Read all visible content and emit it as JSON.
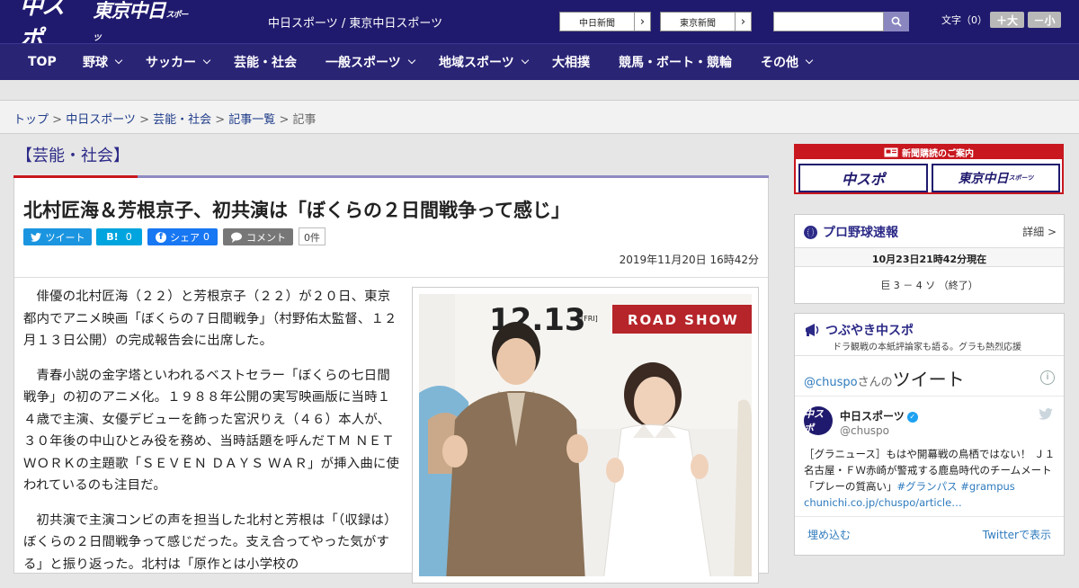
{
  "header": {
    "logo_chuspo": "中スポ",
    "logo_tokyo": "東京中日",
    "logo_tokyo_small": "スポーツ",
    "sites": "中日スポーツ / 東京中日スポーツ",
    "link_chunichi": "中日新聞",
    "link_tokyo": "東京新聞",
    "search_placeholder": "",
    "fontsize_label": "文字（0）",
    "font_plus": "＋大",
    "font_minus": "－小",
    "brand_color": "#201a6e"
  },
  "nav": {
    "items": [
      "TOP",
      "野球",
      "サッカー",
      "芸能・社会",
      "一般スポーツ",
      "地域スポーツ",
      "大相撲",
      "競馬・ボート・競輪",
      "その他"
    ]
  },
  "breadcrumb": {
    "top": "トップ",
    "chuspo": "中日スポーツ",
    "geino": "芸能・社会",
    "list": "記事一覧",
    "current": "記事",
    "sep": " > "
  },
  "article": {
    "category": "【芸能・社会】",
    "headline": "北村匠海＆芳根京子、初共演は「ぼくらの２日間戦争って感じ」",
    "tweet_label": "ツイート",
    "hatena_label": "B!",
    "hatena_count": "0",
    "fb_label": "シェア",
    "fb_count": "0",
    "comment_label": "コメント",
    "comment_count": "0件",
    "date": "2019年11月20日 16時42分",
    "paragraphs": [
      "俳優の北村匠海（２２）と芳根京子（２２）が２０日、東京都内でアニメ映画「ぼくらの７日間戦争」（村野佑太監督、１２月１３日公開）の完成報告会に出席した。",
      "青春小説の金字塔といわれるベストセラー「ぼくらの七日間戦争」の初のアニメ化。１９８８年公開の実写映画版に当時１４歳で主演、女優デビューを飾った宮沢りえ（４６）本人が、３０年後の中山ひとみ役を務め、当時話題を呼んだＴＭ ＮＥＴＷＯＲＫの主題歌「ＳＥＶＥＮ ＤＡＹＳ ＷＡＲ」が挿入曲に使われているのも注目だ。",
      "初共演で主演コンビの声を担当した北村と芳根は「（収録は）ぼくらの２日間戦争って感じだった。支え合ってやった気がする」と振り返った。北村は「原作とは小学校の"
    ],
    "photo_text_date": "12.13",
    "photo_text_fri": "[FRI]",
    "photo_text_show": "ROAD SHOW"
  },
  "sidebar": {
    "ad_title": "新聞購読のご案内",
    "ad_chuspo": "中スポ",
    "ad_tokyo": "東京中日",
    "ad_tokyo_small": "スポーツ",
    "baseball_title": "プロ野球速報",
    "baseball_detail": "詳細 >",
    "baseball_time": "10月23日21時42分現在",
    "baseball_score": "巨 3 － 4 ソ （終了）",
    "tweets_title": "つぶやき中スポ",
    "tweets_sub": "ドラ観戦の本紙評論家も語る。グラも熱烈応援",
    "tw_user_link": "@chuspo",
    "tw_san": "さんの",
    "tw_big": "ツイート",
    "tw_avatar": "中スポ",
    "tw_name": "中日スポーツ",
    "tw_handle": "@chuspo",
    "tw_text_main": "［グラニュース］もはや開幕戦の鳥栖ではない！ Ｊ１名古屋・ＦＷ赤崎が警戒する鹿島時代のチームメート「プレーの質高い」",
    "tw_tags": "#グランパス #grampus",
    "tw_link": "chunichi.co.jp/chuspo/article…",
    "tw_embed": "埋め込む",
    "tw_view": "Twitterで表示"
  }
}
